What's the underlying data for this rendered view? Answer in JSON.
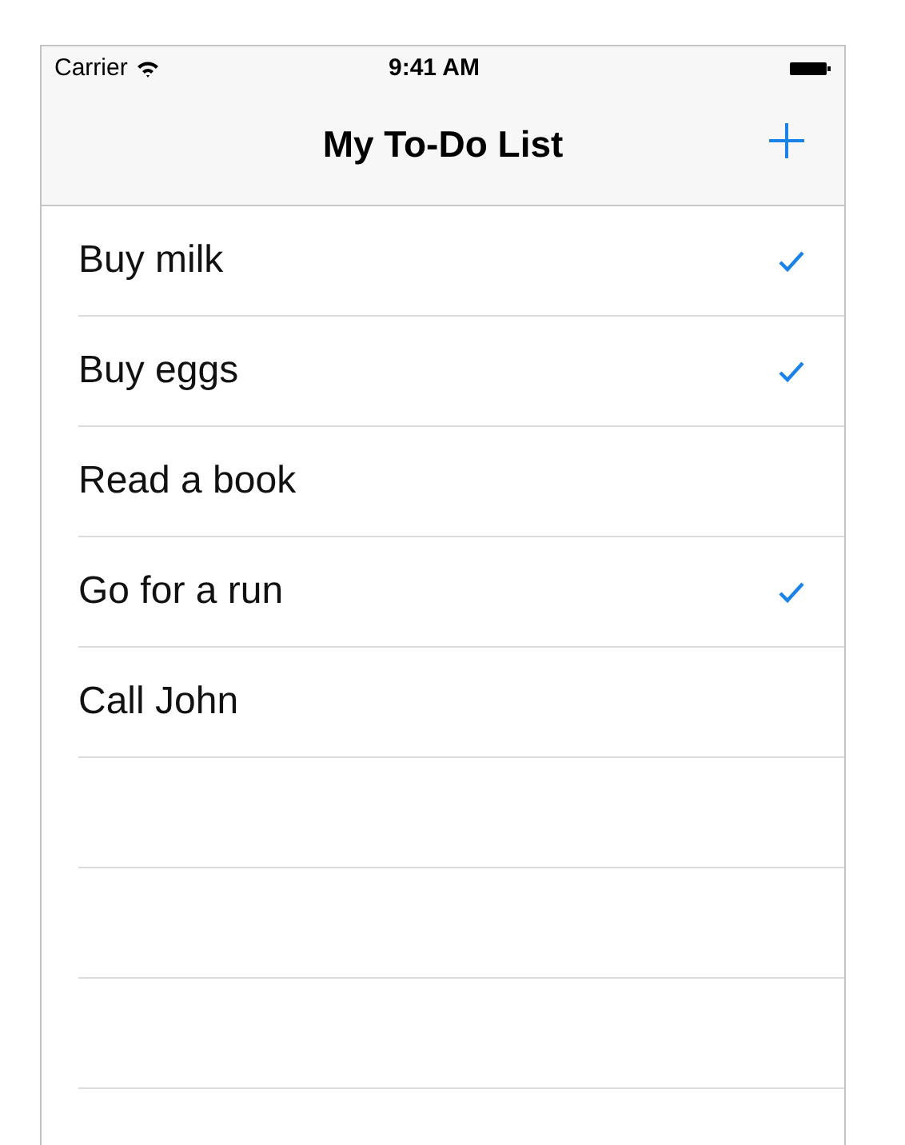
{
  "status_bar": {
    "carrier": "Carrier",
    "time": "9:41 AM"
  },
  "nav_bar": {
    "title": "My To-Do List"
  },
  "items": [
    {
      "label": "Buy milk",
      "checked": true
    },
    {
      "label": "Buy eggs",
      "checked": true
    },
    {
      "label": "Read a book",
      "checked": false
    },
    {
      "label": "Go for a run",
      "checked": true
    },
    {
      "label": "Call John",
      "checked": false
    }
  ]
}
